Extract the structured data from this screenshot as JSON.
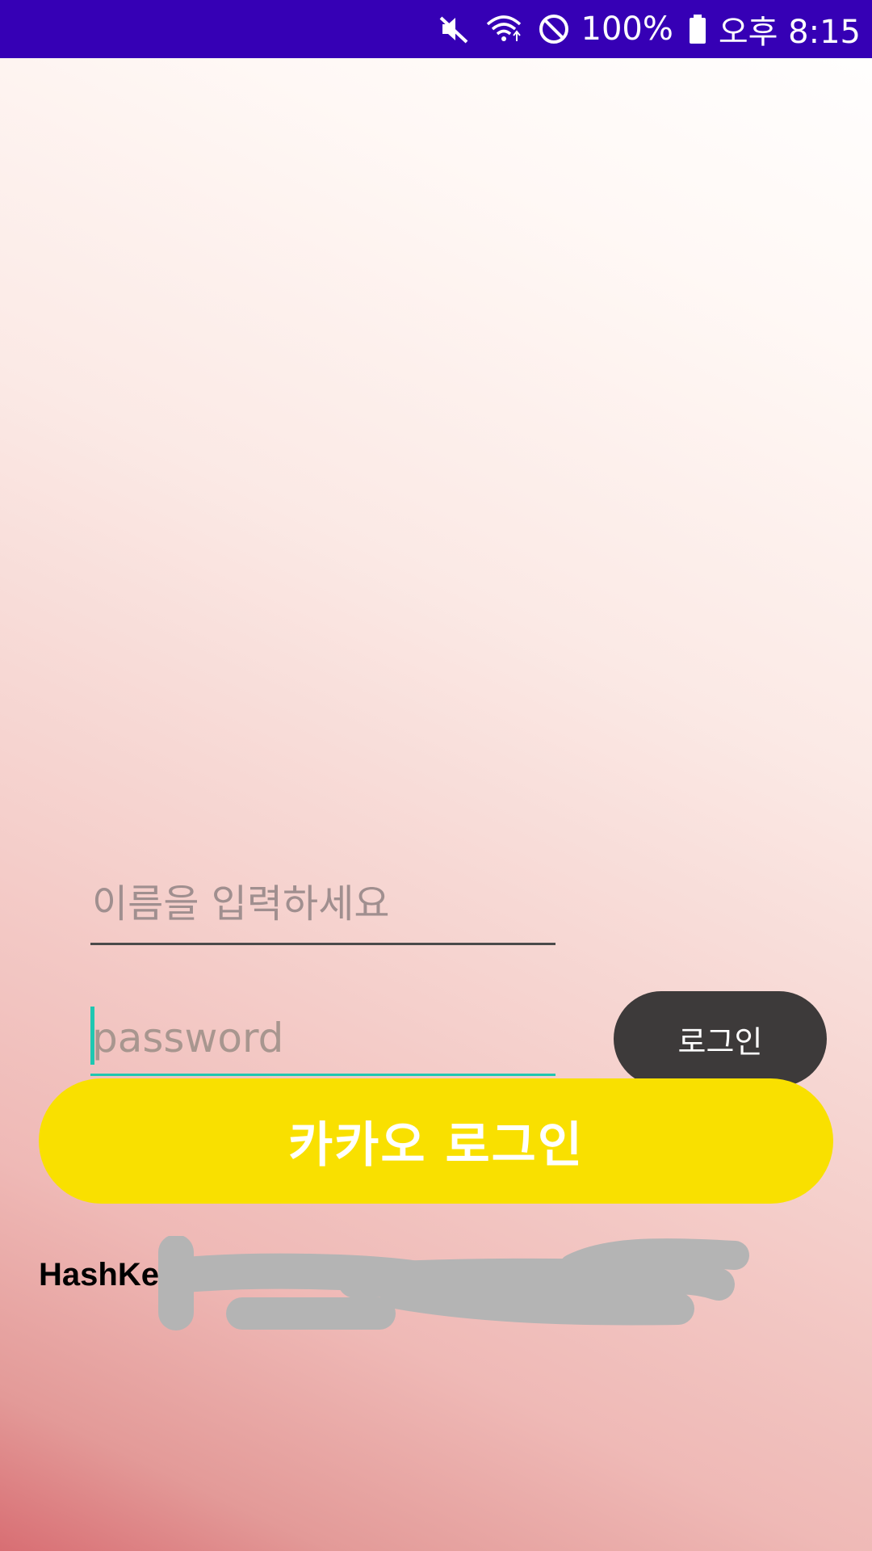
{
  "status_bar": {
    "battery": "100%",
    "time": "오후 8:15",
    "icons": [
      "mute-icon",
      "wifi-icon",
      "do-not-disturb-icon",
      "battery-icon"
    ]
  },
  "login_form": {
    "name_placeholder": "이름을 입력하세요",
    "password_placeholder": "password",
    "login_button": "로그인"
  },
  "kakao": {
    "button_label": "카카오 로그인"
  },
  "footer": {
    "hashkey_label": "HashKe"
  },
  "colors": {
    "status_bar": "#3600b5",
    "kakao_yellow": "#f9e000",
    "login_dark": "#3d3a3a",
    "focus_accent": "#1fc7b1"
  }
}
